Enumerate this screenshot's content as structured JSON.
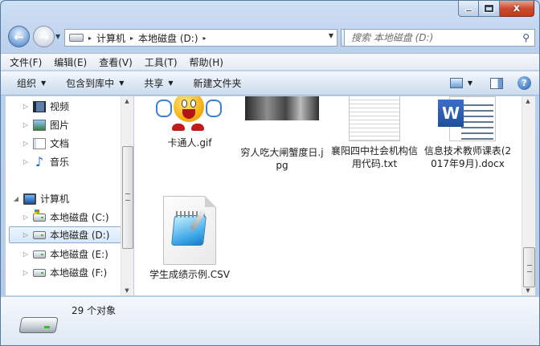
{
  "window": {
    "close_glyph": "x"
  },
  "address_bar": {
    "crumbs": [
      "计算机",
      "本地磁盘 (D:)"
    ],
    "separator": "▸"
  },
  "search": {
    "placeholder": "搜索 本地磁盘 (D:)"
  },
  "menu": {
    "items": [
      "文件(F)",
      "编辑(E)",
      "查看(V)",
      "工具(T)",
      "帮助(H)"
    ]
  },
  "toolbar": {
    "organize": "组织",
    "include_in_library": "包含到库中",
    "share": "共享",
    "new_folder": "新建文件夹"
  },
  "nav_pane": {
    "items": [
      {
        "label": "视频",
        "icon": "video-library-icon"
      },
      {
        "label": "图片",
        "icon": "picture-library-icon"
      },
      {
        "label": "文档",
        "icon": "document-library-icon"
      },
      {
        "label": "音乐",
        "icon": "music-library-icon"
      },
      {
        "label": "计算机",
        "icon": "computer-icon"
      },
      {
        "label": "本地磁盘 (C:)",
        "icon": "system-drive-icon"
      },
      {
        "label": "本地磁盘 (D:)",
        "icon": "drive-icon",
        "selected": true
      },
      {
        "label": "本地磁盘 (E:)",
        "icon": "drive-icon"
      },
      {
        "label": "本地磁盘 (F:)",
        "icon": "drive-icon"
      }
    ]
  },
  "files": [
    {
      "name": "卡通人.gif",
      "type": "gif"
    },
    {
      "name": "穷人吃大闸蟹度日.jpg",
      "type": "jpg"
    },
    {
      "name": "襄阳四中社会机构信用代码.txt",
      "type": "txt"
    },
    {
      "name": "信息技术教师课表(2017年9月).docx",
      "type": "docx"
    },
    {
      "name": "学生成绩示例.CSV",
      "type": "csv"
    }
  ],
  "status": {
    "item_count": "29 个对象"
  },
  "colors": {
    "selection": "#d6e8fa",
    "chrome": "#bcd1ec"
  }
}
